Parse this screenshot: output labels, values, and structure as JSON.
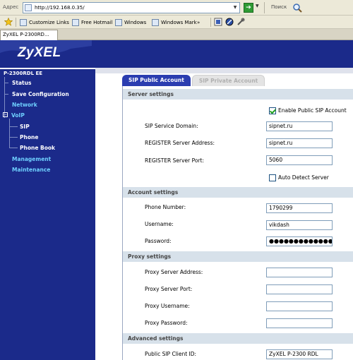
{
  "browser": {
    "address_label": "Адрес",
    "url": "http://192.168.0.35/",
    "search_label": "Поиск",
    "links": [
      {
        "label": "Customize Links"
      },
      {
        "label": "Free Hotmail"
      },
      {
        "label": "Windows"
      },
      {
        "label": "Windows Mark"
      }
    ],
    "tab_title": "ZyXEL P-2300RD..."
  },
  "header": {
    "logo": "ZyXEL"
  },
  "sidebar": {
    "model": "P-2300RDL EE",
    "items": [
      {
        "label": "Status"
      },
      {
        "label": "Save Configuration"
      },
      {
        "label": "Network"
      },
      {
        "label": "VoIP"
      },
      {
        "label": "SIP"
      },
      {
        "label": "Phone"
      },
      {
        "label": "Phone Book"
      },
      {
        "label": "Management"
      },
      {
        "label": "Maintenance"
      }
    ]
  },
  "tabs": {
    "public": "SIP Public Account",
    "private": "SIP Private Account"
  },
  "server": {
    "title": "Server settings",
    "enable_label": "Enable Public SIP Account",
    "enable_checked": true,
    "domain_label": "SIP Service Domain:",
    "domain_value": "sipnet.ru",
    "register_label": "REGISTER Server Address:",
    "register_value": "sipnet.ru",
    "port_label": "REGISTER Server Port:",
    "port_value": "5060",
    "autodetect_label": "Auto Detect Server",
    "autodetect_checked": false
  },
  "account": {
    "title": "Account settings",
    "phone_label": "Phone Number:",
    "phone_value": "1790299",
    "username_label": "Username:",
    "username_value": "vikdash",
    "password_label": "Password:",
    "password_value": "●●●●●●●●●●●●●"
  },
  "proxy": {
    "title": "Proxy settings",
    "address_label": "Proxy Server Address:",
    "port_label": "Proxy Server Port:",
    "username_label": "Proxy Username:",
    "password_label": "Proxy Password:"
  },
  "advanced": {
    "title": "Advanced settings",
    "client_id_label": "Public SIP Client ID:",
    "client_id_value": "ZyXEL P-2300 RDL"
  }
}
